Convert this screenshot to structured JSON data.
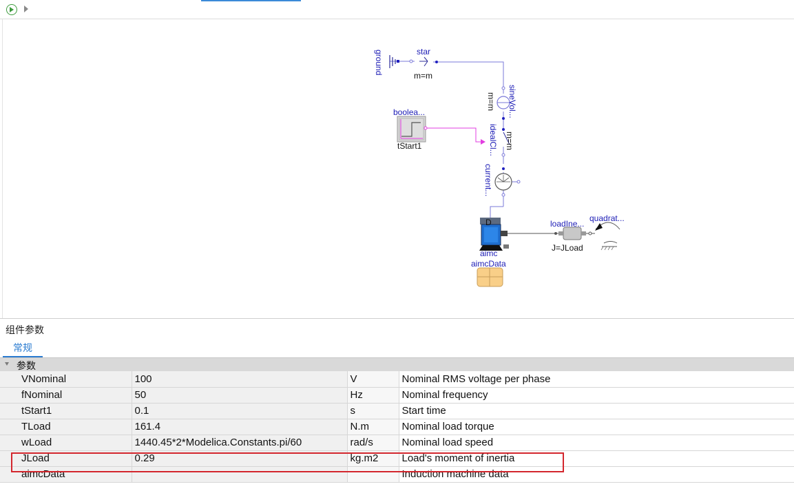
{
  "toolbar": {
    "run_icon": "play-circle-icon",
    "next_icon": "chevron-right-icon"
  },
  "diagram": {
    "labels": {
      "ground": "ground",
      "star": "star",
      "star_param": "m=m",
      "sine_voltage": "sineVol...",
      "sine_param": "m=m",
      "boolean_step": "boolea...",
      "boolean_param": "tStart1",
      "ideal_closer": "idealCl...",
      "closer_param": "m=m",
      "current_sensor": "current...",
      "machine": "aimc",
      "machine_data": "aimcData",
      "load_inertia": "loadIne...",
      "inertia_param": "J=JLoad",
      "quadratic": "quadrat...",
      "machine_letter": "D"
    }
  },
  "panel": {
    "title": "组件参数",
    "tab_label": "常规",
    "group_label": "参数",
    "rows": [
      {
        "name": "VNominal",
        "value": "100",
        "unit": "V",
        "desc": "Nominal RMS voltage per phase"
      },
      {
        "name": "fNominal",
        "value": "50",
        "unit": "Hz",
        "desc": "Nominal frequency"
      },
      {
        "name": "tStart1",
        "value": "0.1",
        "unit": "s",
        "desc": "Start time"
      },
      {
        "name": "TLoad",
        "value": "161.4",
        "unit": "N.m",
        "desc": "Nominal load torque"
      },
      {
        "name": "wLoad",
        "value": "1440.45*2*Modelica.Constants.pi/60",
        "unit": "rad/s",
        "desc": "Nominal load speed"
      },
      {
        "name": "JLoad",
        "value": "0.29",
        "unit": "kg.m2",
        "desc": "Load's moment of inertia"
      },
      {
        "name": "aimcData",
        "value": "",
        "unit": "",
        "desc": "Induction machine data"
      }
    ]
  }
}
